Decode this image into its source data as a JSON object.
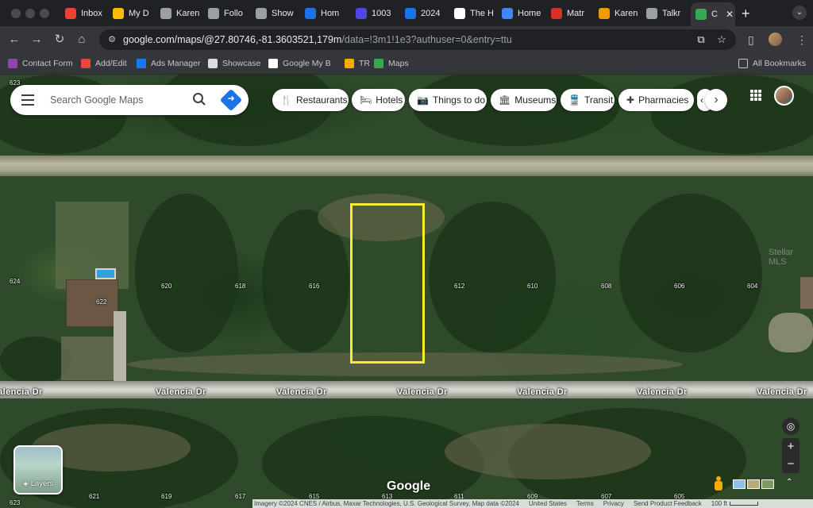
{
  "browser": {
    "tabs": [
      {
        "label": "Inbox",
        "icon": "gmail-icon",
        "color": "#ea4335"
      },
      {
        "label": "My D",
        "icon": "drive-icon",
        "color": "#fbbc04"
      },
      {
        "label": "Karen",
        "icon": "site-icon",
        "color": "#9aa0a6"
      },
      {
        "label": "Follo",
        "icon": "site-icon",
        "color": "#9aa0a6"
      },
      {
        "label": "Show",
        "icon": "site-icon",
        "color": "#9aa0a6"
      },
      {
        "label": "Hom",
        "icon": "site-icon",
        "color": "#1a73e8"
      },
      {
        "label": "1003",
        "icon": "shield-icon",
        "color": "#4f46e5"
      },
      {
        "label": "2024",
        "icon": "site-icon",
        "color": "#1a73e8"
      },
      {
        "label": "The H",
        "icon": "google-icon",
        "color": "#ffffff"
      },
      {
        "label": "Home",
        "icon": "site-icon",
        "color": "#4285f4"
      },
      {
        "label": "Matr",
        "icon": "site-icon",
        "color": "#d93025"
      },
      {
        "label": "Karen",
        "icon": "site-icon",
        "color": "#f29900"
      },
      {
        "label": "Talkr",
        "icon": "site-icon",
        "color": "#9aa0a6"
      },
      {
        "label": "C",
        "icon": "maps-icon",
        "color": "#34a853",
        "active": true
      }
    ],
    "url_main": "google.com/maps/@27.80746,-81.3603521,179m",
    "url_rest": "/data=!3m1!1e3?authuser=0&entry=ttu",
    "bookmarks": [
      {
        "label": "Contact Form",
        "icon": "form-icon",
        "color": "#8e44ad"
      },
      {
        "label": "Add/Edit",
        "icon": "edit-icon",
        "color": "#e8453c"
      },
      {
        "label": "Ads Manager",
        "icon": "facebook-icon",
        "color": "#1877f2"
      },
      {
        "label": "Showcase",
        "icon": "showcase-icon",
        "color": "#dadce0"
      },
      {
        "label": "Google My B",
        "icon": "google-icon",
        "color": "#ffffff"
      },
      {
        "label": "TR",
        "icon": "tr-icon",
        "color": "#f9ab00"
      },
      {
        "label": "Maps",
        "icon": "maps-icon",
        "color": "#34a853"
      }
    ],
    "all_bookmarks": "All Bookmarks"
  },
  "maps": {
    "search_placeholder": "Search Google Maps",
    "chips": [
      {
        "label": "Restaurants",
        "icon": "fork-knife-icon",
        "glyph": "🍴"
      },
      {
        "label": "Hotels",
        "icon": "bed-icon",
        "glyph": "🛏"
      },
      {
        "label": "Things to do",
        "icon": "camera-icon",
        "glyph": "📷"
      },
      {
        "label": "Museums",
        "icon": "museum-icon",
        "glyph": "🏛"
      },
      {
        "label": "Transit",
        "icon": "bus-icon",
        "glyph": "🚆"
      },
      {
        "label": "Pharmacies",
        "icon": "pharmacy-icon",
        "glyph": "✚"
      },
      {
        "label": "‹",
        "icon": "more-chip-icon",
        "glyph": ""
      }
    ],
    "street_name": "Valencia Dr",
    "lot_labels_north": [
      {
        "n": "623"
      },
      {
        "n": "624"
      },
      {
        "n": "622"
      },
      {
        "n": "620"
      },
      {
        "n": "618"
      },
      {
        "n": "616"
      },
      {
        "n": "612"
      },
      {
        "n": "610"
      },
      {
        "n": "608"
      },
      {
        "n": "606"
      },
      {
        "n": "604"
      }
    ],
    "lot_labels_south": [
      {
        "n": "623"
      },
      {
        "n": "621"
      },
      {
        "n": "619"
      },
      {
        "n": "617"
      },
      {
        "n": "615"
      },
      {
        "n": "613"
      },
      {
        "n": "611"
      },
      {
        "n": "609"
      },
      {
        "n": "607"
      },
      {
        "n": "605"
      }
    ],
    "layers_label": "Layers",
    "google_logo": "Google",
    "footer": {
      "imagery": "Imagery ©2024 CNES / Airbus, Maxar Technologies, U.S. Geological Survey, Map data ©2024",
      "country": "United States",
      "terms": "Terms",
      "privacy": "Privacy",
      "feedback": "Send Product Feedback",
      "scale": "100 ft"
    },
    "watermark": "Stellar MLS",
    "parcel_color": "#f5ec2e"
  }
}
